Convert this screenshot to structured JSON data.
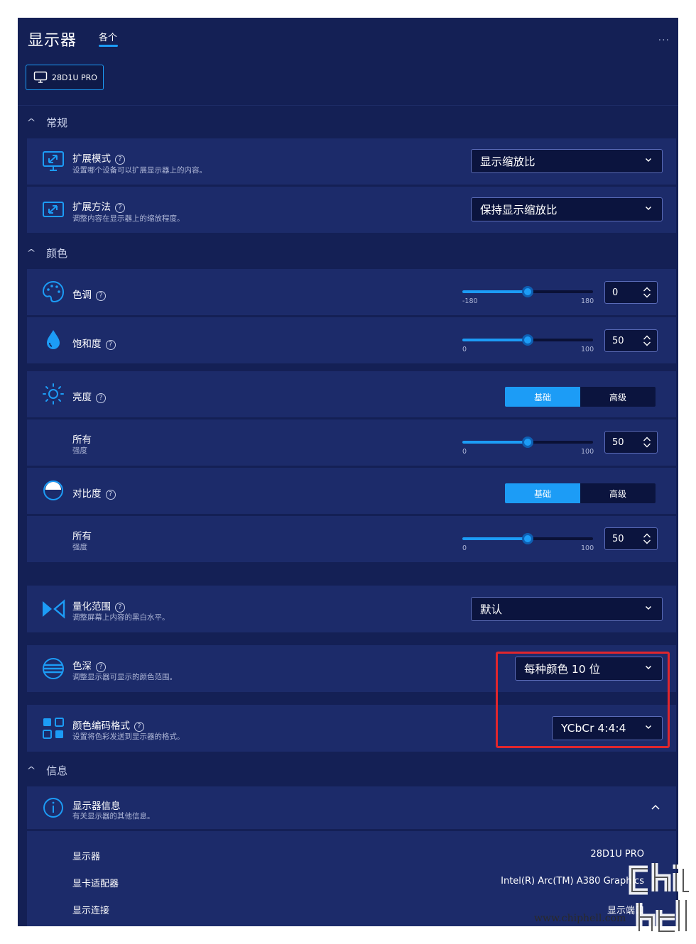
{
  "header": {
    "title": "显示器",
    "tab_label": "各个",
    "more": "..."
  },
  "device": {
    "label": "28D1U PRO"
  },
  "sections": {
    "general": "常规",
    "color": "颜色",
    "info": "信息"
  },
  "general": {
    "extend_mode": {
      "label": "扩展模式",
      "desc": "设置哪个设备可以扩展显示器上的内容。",
      "value": "显示缩放比"
    },
    "extend_method": {
      "label": "扩展方法",
      "desc": "调整内容在显示器上的缩放程度。",
      "value": "保持显示缩放比"
    }
  },
  "color": {
    "hue": {
      "label": "色调",
      "value": "0",
      "min": "-180",
      "max": "180",
      "fraction": 0.5
    },
    "saturation": {
      "label": "饱和度",
      "value": "50",
      "min": "0",
      "max": "100",
      "fraction": 0.5
    },
    "brightness": {
      "label": "亮度",
      "seg_basic": "基础",
      "seg_advanced": "高级",
      "all_label": "所有",
      "all_sub": "强度",
      "value": "50",
      "min": "0",
      "max": "100",
      "fraction": 0.5
    },
    "contrast": {
      "label": "对比度",
      "seg_basic": "基础",
      "seg_advanced": "高级",
      "all_label": "所有",
      "all_sub": "强度",
      "value": "50",
      "min": "0",
      "max": "100",
      "fraction": 0.5
    },
    "quant_range": {
      "label": "量化范围",
      "desc": "调整屏幕上内容的黑白水平。",
      "value": "默认"
    },
    "color_depth": {
      "label": "色深",
      "desc": "调整显示器可显示的颜色范围。",
      "value": "每种颜色 10 位"
    },
    "encoding": {
      "label": "颜色编码格式",
      "desc": "设置将色彩发送到显示器的格式。",
      "value": "YCbCr 4:4:4"
    }
  },
  "info": {
    "display_info": {
      "label": "显示器信息",
      "desc": "有关显示器的其他信息。"
    },
    "rows": [
      {
        "key": "显示器",
        "value": "28D1U PRO"
      },
      {
        "key": "显卡适配器",
        "value": "Intel(R) Arc(TM) A380 Graphics"
      },
      {
        "key": "显示连接",
        "value": "显示端口"
      }
    ]
  },
  "watermark": {
    "url": "www.chiphell.com"
  },
  "colors": {
    "accent": "#1c9cf6",
    "background": "#142055",
    "row": "#1c2b6a",
    "highlight": "#e0262d"
  }
}
